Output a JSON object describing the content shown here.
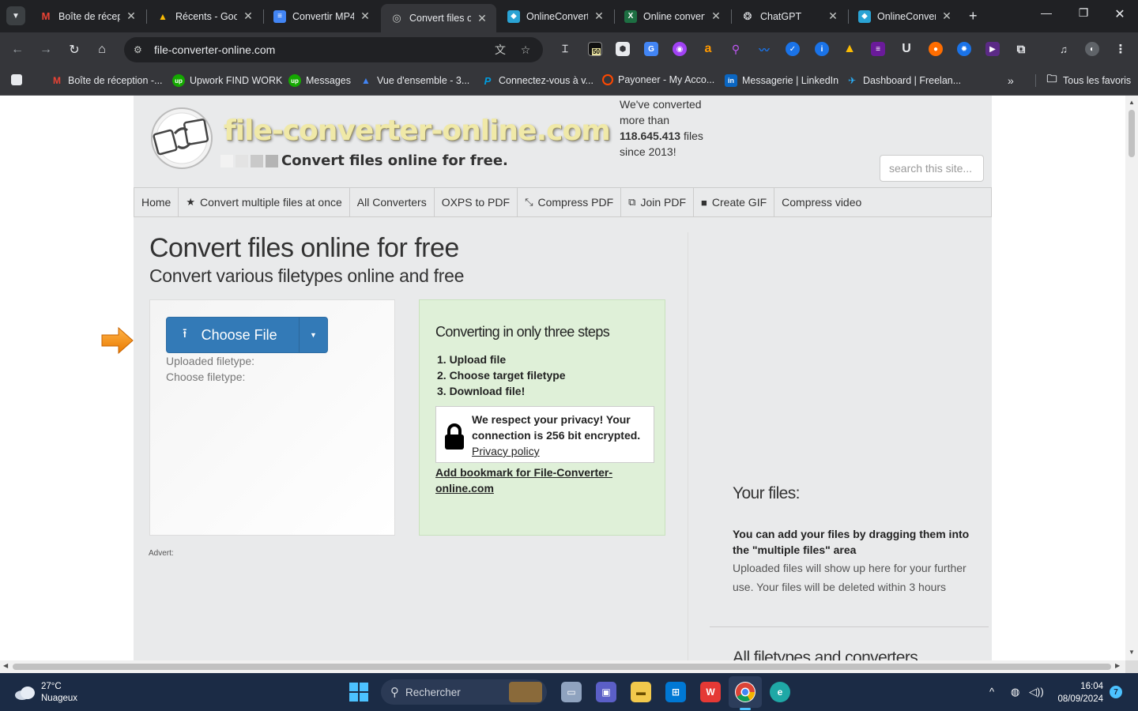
{
  "browser": {
    "tabs": [
      {
        "title": "Boîte de réception",
        "favicon": "gmail-icon",
        "color": "#ea4335",
        "glyph": "M"
      },
      {
        "title": "Récents - Google Drive",
        "favicon": "google-drive-icon",
        "color": "#1fa463",
        "glyph": "▲"
      },
      {
        "title": "Convertir MP4",
        "favicon": "google-docs-icon",
        "color": "#4285f4",
        "glyph": "≡"
      },
      {
        "title": "Convert files online",
        "favicon": "site-icon",
        "color": "#9aa0a6",
        "glyph": "◎"
      },
      {
        "title": "OnlineConvert",
        "favicon": "onlineconvert-icon",
        "color": "#2aa3d4",
        "glyph": "◆"
      },
      {
        "title": "Online converter",
        "favicon": "excel-icon",
        "color": "#1d6f42",
        "glyph": "X"
      },
      {
        "title": "ChatGPT",
        "favicon": "chatgpt-icon",
        "color": "#202124",
        "glyph": "❂"
      },
      {
        "title": "OnlineConvert",
        "favicon": "onlineconvert-icon",
        "color": "#2aa3d4",
        "glyph": "◆"
      }
    ],
    "url": "file-converter-online.com",
    "extension_badge": "50",
    "bookmarks": [
      {
        "label": "Boîte de réception -...",
        "icon": "gmail-icon",
        "color": "#ea4335",
        "glyph": "M"
      },
      {
        "label": "Upwork FIND WORK",
        "icon": "upwork-icon",
        "color": "#14a800",
        "glyph": "up"
      },
      {
        "label": "Messages",
        "icon": "upwork-icon",
        "color": "#14a800",
        "glyph": "up"
      },
      {
        "label": "Vue d'ensemble - 3...",
        "icon": "google-ads-icon",
        "color": "#4285f4",
        "glyph": "▲"
      },
      {
        "label": "Connectez-vous à v...",
        "icon": "paypal-icon",
        "color": "#003087",
        "glyph": "P"
      },
      {
        "label": "Payoneer - My Acco...",
        "icon": "payoneer-icon",
        "color": "#ff4800",
        "glyph": "◯"
      },
      {
        "label": "Messagerie | LinkedIn",
        "icon": "linkedin-icon",
        "color": "#0a66c2",
        "glyph": "in"
      },
      {
        "label": "Dashboard | Freelan...",
        "icon": "freelancer-icon",
        "color": "#29b2fe",
        "glyph": "✈"
      }
    ],
    "all_bookmarks_label": "Tous les favoris"
  },
  "site": {
    "logo_text": "file-converter-online.com",
    "tagline": "Convert files online for free.",
    "stats": {
      "line1": "We've converted",
      "line2": "more than",
      "count": "118.645.413",
      "count_suffix": " files",
      "line4": "since 2013!"
    },
    "search_placeholder": "search this site...",
    "nav": [
      {
        "label": "Home",
        "icon": ""
      },
      {
        "label": "Convert multiple files at once",
        "icon": "★"
      },
      {
        "label": "All Converters",
        "icon": ""
      },
      {
        "label": "OXPS to PDF",
        "icon": ""
      },
      {
        "label": "Compress PDF",
        "icon": "⤡"
      },
      {
        "label": "Join PDF",
        "icon": "⧉"
      },
      {
        "label": "Create GIF",
        "icon": "■"
      },
      {
        "label": "Compress video",
        "icon": ""
      }
    ],
    "heading": "Convert files online for free",
    "subheading": "Convert various filetypes online and free",
    "upload": {
      "button_label": "Choose File",
      "uploaded_filetype_label": "Uploaded filetype:",
      "choose_filetype_label": "Choose filetype:"
    },
    "steps": {
      "title": "Converting in only three steps",
      "items": [
        "1. Upload file",
        "2. Choose target filetype",
        "3. Download file!"
      ],
      "privacy_text": "We respect your privacy! Your connection is 256 bit encrypted.",
      "privacy_link": "Privacy policy",
      "bookmark_link": "Add bookmark for File-Converter-online.com"
    },
    "advert_label": "Advert:",
    "your_files": {
      "title": "Your files:",
      "bold_text": "You can add your files by dragging them into the \"multiple files\" area",
      "text": "Uploaded files will show up here for your further use. Your files will be deleted within 3 hours"
    },
    "all_filetypes_title": "All filetypes and converters"
  },
  "taskbar": {
    "weather_temp": "27°C",
    "weather_desc": "Nuageux",
    "search_label": "Rechercher",
    "time": "16:04",
    "date": "08/09/2024",
    "notifications": "7"
  }
}
